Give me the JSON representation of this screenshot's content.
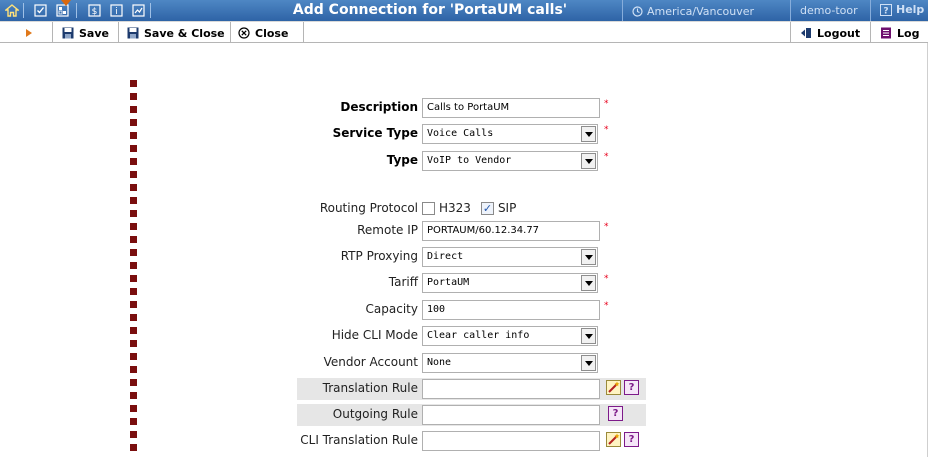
{
  "header": {
    "title": "Add Connection for 'PortaUM calls'",
    "timezone": "America/Vancouver",
    "user": "demo-toor",
    "help_label": "Help",
    "nav_icons": [
      "home-icon",
      "checkbox-icon",
      "grid-icon",
      "dollar-icon",
      "info-icon",
      "chart-icon"
    ],
    "accent_color": "#3a72b6",
    "marker_color": "#d8680f"
  },
  "toolbar": {
    "save_label": "Save",
    "save_close_label": "Save & Close",
    "close_label": "Close",
    "logout_label": "Logout",
    "log_label": "Log"
  },
  "form": {
    "description": {
      "label": "Description",
      "value": "Calls to PortaUM",
      "required": "*"
    },
    "service_type": {
      "label": "Service Type",
      "value": "Voice Calls",
      "required": "*"
    },
    "type": {
      "label": "Type",
      "value": "VoIP to Vendor",
      "required": "*"
    },
    "routing_protocol": {
      "label": "Routing Protocol",
      "options": [
        {
          "label": "H323",
          "checked": false
        },
        {
          "label": "SIP",
          "checked": true
        }
      ]
    },
    "remote_ip": {
      "label": "Remote IP",
      "value": "PORTAUM/60.12.34.77",
      "required": "*"
    },
    "rtp_proxying": {
      "label": "RTP Proxying",
      "value": "Direct"
    },
    "tariff": {
      "label": "Tariff",
      "value": "PortaUM",
      "required": "*"
    },
    "capacity": {
      "label": "Capacity",
      "value": "100",
      "required": "*"
    },
    "hide_cli_mode": {
      "label": "Hide CLI Mode",
      "value": "Clear caller info"
    },
    "vendor_account": {
      "label": "Vendor Account",
      "value": "None"
    },
    "translation_rule": {
      "label": "Translation Rule",
      "value": ""
    },
    "outgoing_rule": {
      "label": "Outgoing Rule",
      "value": ""
    },
    "cli_translation_rule": {
      "label": "CLI Translation Rule",
      "value": ""
    }
  }
}
